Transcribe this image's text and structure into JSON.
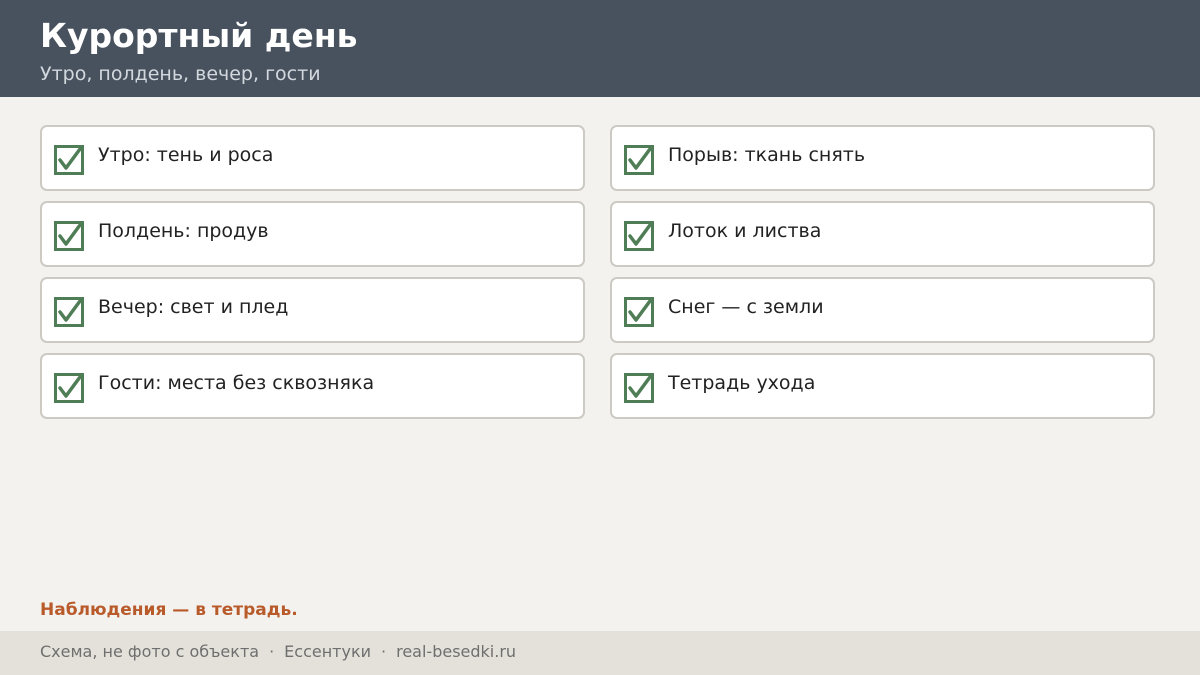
{
  "header": {
    "title": "Курортный день",
    "subtitle": "Утро, полдень, вечер, гости"
  },
  "checklist": {
    "left": [
      {
        "label": "Утро: тень и роса",
        "checked": true
      },
      {
        "label": "Полдень: продув",
        "checked": true
      },
      {
        "label": "Вечер: свет и плед",
        "checked": true
      },
      {
        "label": "Гости: места без сквозняка",
        "checked": true
      }
    ],
    "right": [
      {
        "label": "Порыв: ткань снять",
        "checked": true
      },
      {
        "label": "Лоток и листва",
        "checked": true
      },
      {
        "label": "Снег — с земли",
        "checked": true
      },
      {
        "label": "Тетрадь ухода",
        "checked": true
      }
    ]
  },
  "note": "Наблюдения — в тетрадь.",
  "footer": {
    "part1": "Схема, не фото с объекта",
    "separator": "·",
    "part2": "Ессентуки",
    "part3": "real-besedki.ru"
  },
  "colors": {
    "header_bg": "#48525e",
    "check_green": "#4f7d55",
    "note_orange": "#b85a2a",
    "footer_bg": "#e4e1da"
  },
  "icons": {
    "check": "checkbox-checked-icon"
  }
}
